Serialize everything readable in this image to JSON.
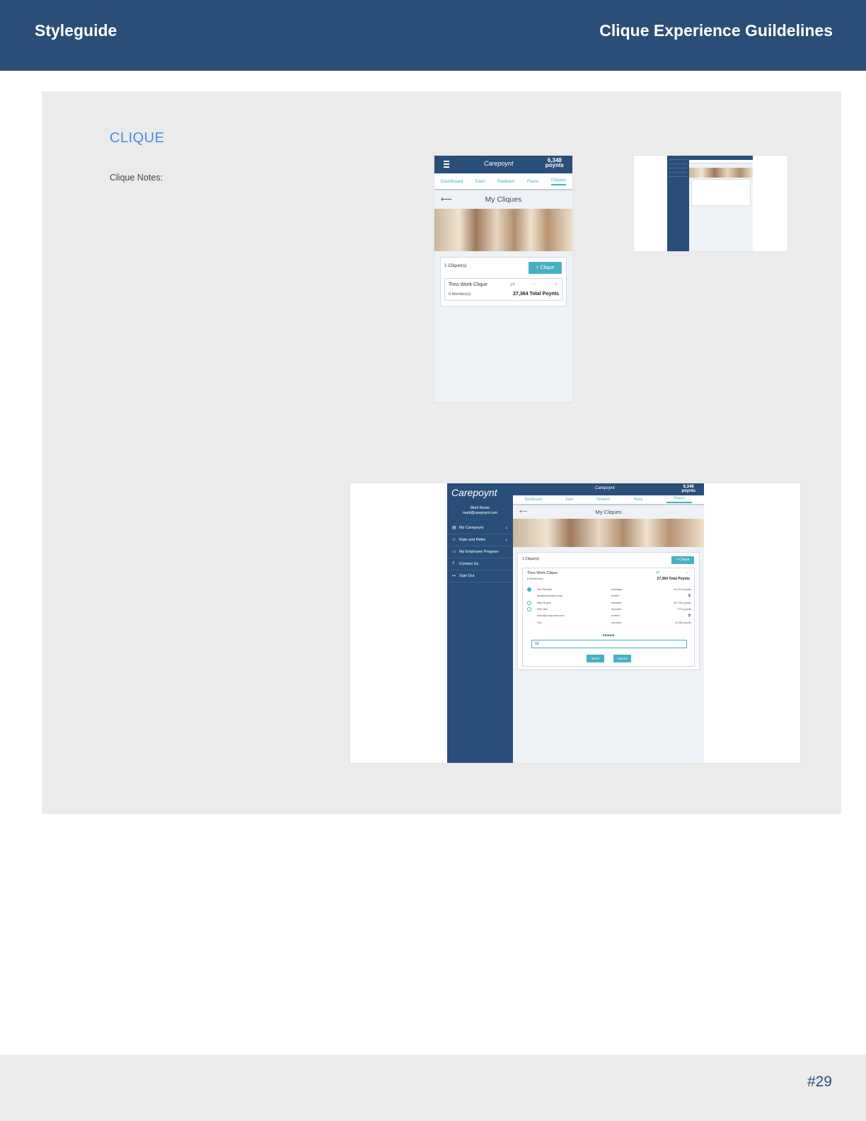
{
  "header": {
    "left_title": "Styleguide",
    "right_title": "Clique Experience Guildelines"
  },
  "section": {
    "title": "CLIQUE",
    "notes_label": "Clique Notes:"
  },
  "footer": {
    "page_number": "#29"
  },
  "mobile": {
    "logo": "Carepoynt",
    "points_value": "6,348",
    "points_label": "poynts",
    "tabs": [
      "Dashboard",
      "Earn",
      "Redeem",
      "Plans",
      "Cliques"
    ],
    "title": "My Cliques",
    "back": "⟵",
    "clique_count": "1 Clique(s)",
    "add_button": "+ Clique",
    "clique": {
      "name": "Tims Work Clique",
      "members": "6 Member(s)",
      "total": "27,364 Total Poynts"
    }
  },
  "desktop": {
    "brand": "Carepoynt",
    "user_name": "Mark Reese",
    "user_email": "mark@carepoynt.com",
    "menu": [
      "My Carepoynt",
      "Rate and Refer",
      "My Employee Program",
      "Contact Us",
      "Sign Out"
    ],
    "logo": "Carepoynt",
    "points_value": "6,348",
    "points_label": "poynts",
    "tabs": [
      "Dashboard",
      "Earn",
      "Redeem",
      "Plans",
      "Cliques"
    ],
    "title": "My Cliques",
    "back": "⟵",
    "clique_count": "1 Clique(s)",
    "add_button": "+ Clique",
    "clique": {
      "name": "Tims Work Clique",
      "members": "6 Member(s)",
      "total": "27,364 Total Poynts"
    },
    "member_rows": [
      {
        "name": "Tim Stanley",
        "role": "manager",
        "points": "10,016 poynts"
      },
      {
        "name": "lisa@carepoynt.com",
        "role": "invited",
        "points": ""
      },
      {
        "name": "Mila Noyes",
        "role": "member",
        "points": "10,730 poynts"
      },
      {
        "name": "Neil Jain",
        "role": "member",
        "points": "270 poynts"
      },
      {
        "name": "chris@carepoynt.com",
        "role": "invited",
        "points": ""
      },
      {
        "name": "You",
        "role": "member",
        "points": "6,348 poynts"
      }
    ],
    "amount_label": "Amount",
    "amount_value": "10",
    "send_button": "Send",
    "cancel_button": "Cancel"
  }
}
